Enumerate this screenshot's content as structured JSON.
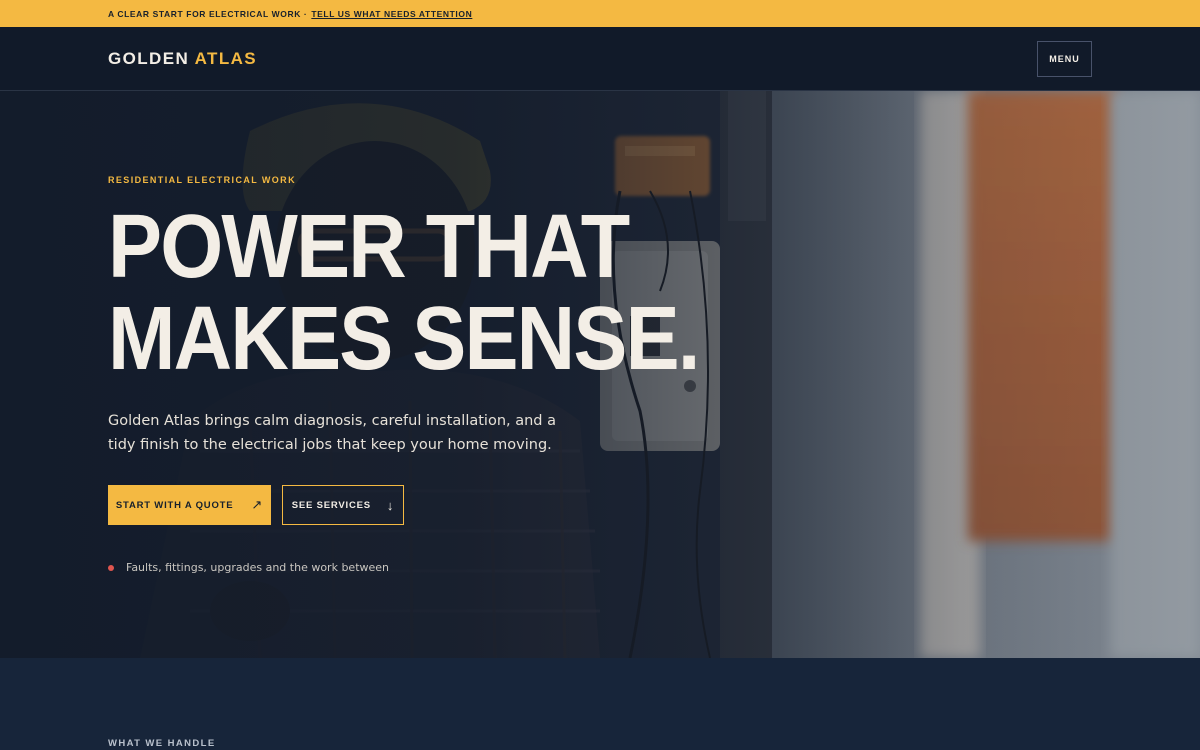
{
  "announcement": {
    "text": "A CLEAR START FOR ELECTRICAL WORK ·",
    "link_label": "TELL US WHAT NEEDS ATTENTION"
  },
  "header": {
    "brand_first": "GOLDEN",
    "brand_second": "ATLAS",
    "menu_label": "MENU"
  },
  "hero": {
    "eyebrow": "RESIDENTIAL ELECTRICAL WORK",
    "headline_line1": "POWER THAT",
    "headline_line2": "MAKES SENSE.",
    "lede": "Golden Atlas brings calm diagnosis, careful installation, and a tidy finish to the electrical jobs that keep your home moving.",
    "primary_cta": "START WITH A QUOTE",
    "primary_cta_icon": "↗",
    "secondary_cta": "SEE SERVICES",
    "secondary_cta_icon": "↓",
    "tagline": "Faults, fittings, upgrades and the work between"
  },
  "section": {
    "label": "WHAT WE HANDLE"
  },
  "colors": {
    "accent": "#f4b942",
    "navy": "#111a29",
    "cream": "#f3eee6",
    "status_dot": "#e0554f"
  }
}
